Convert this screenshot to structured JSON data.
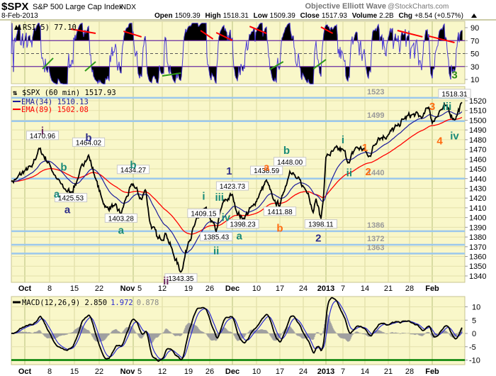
{
  "header": {
    "symbol": "$SPX",
    "name": "S&P 500 Large Cap Index",
    "exchange": "INDX",
    "brand": "Objective Elliott Wave",
    "source": "@StockCharts.com",
    "date": "8-Feb-2013",
    "open_label": "Open",
    "open": "1509.39",
    "high_label": "High",
    "high": "1518.31",
    "low_label": "Low",
    "low": "1509.39",
    "close_label": "Close",
    "close": "1517.93",
    "volume_label": "Volume",
    "volume": "2.2B",
    "chg_label": "Chg",
    "chg": "+8.54 (+0.57%)",
    "chg_icon": "triangle-up-icon"
  },
  "colors": {
    "panel_bg": "#f9f7c9",
    "price": "#000000",
    "ema34": "#1c1c9c",
    "ema89": "#ff0000",
    "level_line": "#9cc8ec",
    "rsi_line": "#4b3bd6",
    "macd_line": "#000000",
    "signal_line": "#2a2ad0",
    "histogram": "#a0a0a0",
    "wave_purple": "#6e2a60",
    "wave_navy": "#2e2e8a",
    "wave_teal": "#198a78",
    "wave_orange": "#ff6a10",
    "wave_green": "#2e8a1a"
  },
  "chart_data": [
    {
      "type": "line",
      "panel": "rsi",
      "legend": "RSI(5) 77.10",
      "ylim": [
        0,
        100
      ],
      "yticks": [
        90,
        70,
        50,
        30,
        10
      ],
      "overbought": 70,
      "oversold": 30,
      "annotations": [
        {
          "kind": "trendline",
          "color": "red",
          "from": [
            "2012-10-14",
            87.8
          ],
          "to": [
            "2012-10-21",
            81.2
          ]
        },
        {
          "kind": "trendline",
          "color": "red",
          "from": [
            "2012-11-01",
            84.5
          ],
          "to": [
            "2012-11-07",
            75.8
          ]
        },
        {
          "kind": "trendline",
          "color": "red",
          "from": [
            "2012-11-23",
            85.6
          ],
          "to": [
            "2012-11-27",
            72.5
          ]
        },
        {
          "kind": "trendline",
          "color": "red",
          "from": [
            "2012-11-28",
            82.3
          ],
          "to": [
            "2012-12-03",
            70.3
          ]
        },
        {
          "kind": "trendline",
          "color": "red",
          "from": [
            "2012-12-08",
            92
          ],
          "to": [
            "2012-12-13",
            81.2
          ]
        },
        {
          "kind": "trendline",
          "color": "red",
          "from": [
            "2012-12-31",
            91
          ],
          "to": [
            "2013-01-04",
            81.2
          ]
        },
        {
          "kind": "trendline",
          "color": "red",
          "from": [
            "2013-01-24",
            85.6
          ],
          "to": [
            "2013-02-01",
            75.8
          ]
        },
        {
          "kind": "trendline",
          "color": "red",
          "from": [
            "2013-02-03",
            76.9
          ],
          "to": [
            "2013-02-07",
            67
          ]
        },
        {
          "kind": "trendline",
          "color": "green",
          "from": [
            "2012-10-06",
            26.4
          ],
          "to": [
            "2012-10-09",
            42.9
          ]
        },
        {
          "kind": "trendline",
          "color": "green",
          "from": [
            "2012-10-18",
            23
          ],
          "to": [
            "2012-10-21",
            37.4
          ]
        },
        {
          "kind": "trendline",
          "color": "green",
          "from": [
            "2012-11-12",
            15.5
          ],
          "to": [
            "2012-11-17",
            19.9
          ]
        },
        {
          "kind": "trendline",
          "color": "green",
          "from": [
            "2012-12-14",
            25.3
          ],
          "to": [
            "2012-12-18",
            37.4
          ]
        },
        {
          "kind": "trendline",
          "color": "green",
          "from": [
            "2012-12-28",
            26.4
          ],
          "to": [
            "2013-01-02",
            40.7
          ]
        }
      ],
      "wave_labels": [
        {
          "text": "3",
          "color": "wave_green",
          "date": "2013-02-07",
          "value": 17
        }
      ]
    },
    {
      "type": "line",
      "panel": "price",
      "title": "$SPX (60 min) 1517.93",
      "ylim": [
        1335,
        1528
      ],
      "yticks": [
        1520,
        1510,
        1500,
        1490,
        1480,
        1470,
        1460,
        1450,
        1440,
        1430,
        1420,
        1410,
        1400,
        1390,
        1380,
        1370,
        1360,
        1350,
        1340
      ],
      "series": [
        {
          "name": "$SPX (60 min)",
          "points": [
            [
              "2012-09-26",
              1437
            ],
            [
              "2012-09-28",
              1440
            ],
            [
              "2012-10-01",
              1448
            ],
            [
              "2012-10-03",
              1452
            ],
            [
              "2012-10-05",
              1471
            ],
            [
              "2012-10-08",
              1455
            ],
            [
              "2012-10-10",
              1440
            ],
            [
              "2012-10-12",
              1430
            ],
            [
              "2012-10-14",
              1425.5
            ],
            [
              "2012-10-16",
              1440
            ],
            [
              "2012-10-18",
              1458
            ],
            [
              "2012-10-19",
              1464
            ],
            [
              "2012-10-21",
              1440
            ],
            [
              "2012-10-23",
              1420
            ],
            [
              "2012-10-25",
              1410
            ],
            [
              "2012-10-28",
              1412
            ],
            [
              "2012-10-31",
              1403.3
            ],
            [
              "2012-11-02",
              1420
            ],
            [
              "2012-11-05",
              1434.3
            ],
            [
              "2012-11-07",
              1418
            ],
            [
              "2012-11-08",
              1430
            ],
            [
              "2012-11-09",
              1395
            ],
            [
              "2012-11-11",
              1378
            ],
            [
              "2012-11-13",
              1384
            ],
            [
              "2012-11-15",
              1362
            ],
            [
              "2012-11-17",
              1343.4
            ],
            [
              "2012-11-19",
              1375
            ],
            [
              "2012-11-21",
              1392
            ],
            [
              "2012-11-24",
              1409.2
            ],
            [
              "2012-11-26",
              1400
            ],
            [
              "2012-11-28",
              1385.4
            ],
            [
              "2012-11-30",
              1415
            ],
            [
              "2012-12-03",
              1423.7
            ],
            [
              "2012-12-04",
              1408
            ],
            [
              "2012-12-06",
              1398.2
            ],
            [
              "2012-12-09",
              1412
            ],
            [
              "2012-12-11",
              1425
            ],
            [
              "2012-12-13",
              1438.6
            ],
            [
              "2012-12-15",
              1418
            ],
            [
              "2012-12-17",
              1411.9
            ],
            [
              "2012-12-18",
              1425
            ],
            [
              "2012-12-20",
              1448
            ],
            [
              "2012-12-22",
              1440
            ],
            [
              "2012-12-24",
              1432
            ],
            [
              "2012-12-26",
              1425
            ],
            [
              "2012-12-28",
              1405
            ],
            [
              "2012-12-29",
              1420
            ],
            [
              "2012-12-31",
              1398.1
            ],
            [
              "2013-01-01",
              1420
            ],
            [
              "2013-01-02",
              1462
            ],
            [
              "2013-01-04",
              1468
            ],
            [
              "2013-01-07",
              1470
            ],
            [
              "2013-01-09",
              1456
            ],
            [
              "2013-01-11",
              1472
            ],
            [
              "2013-01-14",
              1470
            ],
            [
              "2013-01-15",
              1462
            ],
            [
              "2013-01-18",
              1482
            ],
            [
              "2013-01-21",
              1485
            ],
            [
              "2013-01-24",
              1494
            ],
            [
              "2013-01-26",
              1501
            ],
            [
              "2013-01-29",
              1506
            ],
            [
              "2013-02-01",
              1503
            ],
            [
              "2013-02-03",
              1514
            ],
            [
              "2013-02-04",
              1497
            ],
            [
              "2013-02-05",
              1510
            ],
            [
              "2013-02-06",
              1514
            ],
            [
              "2013-02-07",
              1500
            ],
            [
              "2013-02-08",
              1518.3
            ]
          ]
        }
      ],
      "legend": [
        {
          "label": "EMA(34) 1510.13",
          "color": "ema34"
        },
        {
          "label": "EMA(89) 1502.08",
          "color": "ema89"
        }
      ],
      "levels": [
        {
          "value": 1523,
          "label": "1523"
        },
        {
          "value": 1499,
          "label": "1499"
        },
        {
          "value": 1440,
          "label": "1440"
        },
        {
          "value": 1386,
          "label": "1386"
        },
        {
          "value": 1372,
          "label": "1372"
        },
        {
          "value": 1363,
          "label": "1363"
        }
      ],
      "price_boxes": [
        {
          "text": "1470.96",
          "date": "2012-10-06",
          "price": 1483
        },
        {
          "text": "1464.02",
          "date": "2012-10-19",
          "price": 1476
        },
        {
          "text": "1425.53",
          "date": "2012-10-14",
          "price": 1419
        },
        {
          "text": "1434.27",
          "date": "2012-11-05",
          "price": 1448
        },
        {
          "text": "1403.28",
          "date": "2012-10-31",
          "price": 1398
        },
        {
          "text": "1343.35",
          "date": "2012-11-17",
          "price": 1336.5
        },
        {
          "text": "1409.15",
          "date": "2012-11-24",
          "price": 1403
        },
        {
          "text": "1423.73",
          "date": "2012-12-03",
          "price": 1431
        },
        {
          "text": "1385.43",
          "date": "2012-11-28",
          "price": 1379
        },
        {
          "text": "1398.23",
          "date": "2012-12-06",
          "price": 1392
        },
        {
          "text": "1438.59",
          "date": "2012-12-13",
          "price": 1447
        },
        {
          "text": "1448.00",
          "date": "2012-12-20",
          "price": 1456
        },
        {
          "text": "1411.88",
          "date": "2012-12-17",
          "price": 1405
        },
        {
          "text": "1398.11",
          "date": "2012-12-31",
          "price": 1392
        },
        {
          "text": "1518.31",
          "date": "2013-02-07",
          "price": 1526
        }
      ],
      "wave_labels": [
        {
          "text": "i",
          "color": "wave_purple",
          "date": "2012-10-06",
          "price": 1489
        },
        {
          "text": "b",
          "color": "wave_navy",
          "date": "2012-10-19",
          "price": 1482
        },
        {
          "text": "b",
          "color": "wave_teal",
          "date": "2012-10-12",
          "price": 1452
        },
        {
          "text": "a",
          "color": "wave_teal",
          "date": "2012-10-10",
          "price": 1424
        },
        {
          "text": "a",
          "color": "wave_navy",
          "date": "2012-10-13",
          "price": 1408
        },
        {
          "text": "b",
          "color": "wave_teal",
          "date": "2012-11-05",
          "price": 1454
        },
        {
          "text": "a",
          "color": "wave_teal",
          "date": "2012-10-31",
          "price": 1387
        },
        {
          "text": "ii",
          "color": "wave_purple",
          "date": "2012-11-13",
          "price": 1335
        },
        {
          "text": "i",
          "color": "wave_teal",
          "date": "2012-11-24",
          "price": 1422
        },
        {
          "text": "iii",
          "color": "wave_teal",
          "date": "2012-11-29",
          "price": 1421
        },
        {
          "text": "iv",
          "color": "wave_teal",
          "date": "2012-12-01",
          "price": 1400
        },
        {
          "text": "1",
          "color": "wave_navy",
          "date": "2012-12-02",
          "price": 1448
        },
        {
          "text": "ii",
          "color": "wave_teal",
          "date": "2012-11-28",
          "price": 1366
        },
        {
          "text": "a",
          "color": "wave_teal",
          "date": "2012-12-05",
          "price": 1381
        },
        {
          "text": "a",
          "color": "wave_orange",
          "date": "2012-12-13",
          "price": 1452
        },
        {
          "text": "b",
          "color": "wave_teal",
          "date": "2012-12-19",
          "price": 1469
        },
        {
          "text": "b",
          "color": "wave_orange",
          "date": "2012-12-17",
          "price": 1389
        },
        {
          "text": "2",
          "color": "wave_navy",
          "date": "2012-12-30",
          "price": 1379
        },
        {
          "text": "i",
          "color": "wave_teal",
          "date": "2013-01-07",
          "price": 1480
        },
        {
          "text": "ii",
          "color": "wave_teal",
          "date": "2013-01-09",
          "price": 1446
        },
        {
          "text": "1",
          "color": "wave_orange",
          "date": "2013-01-14",
          "price": 1472
        },
        {
          "text": "2",
          "color": "wave_orange",
          "date": "2013-01-15",
          "price": 1447
        },
        {
          "text": "3",
          "color": "wave_orange",
          "date": "2013-02-04",
          "price": 1514
        },
        {
          "text": "iii",
          "color": "wave_teal",
          "date": "2013-02-06",
          "price": 1514
        },
        {
          "text": "4",
          "color": "wave_orange",
          "date": "2013-02-05",
          "price": 1479
        },
        {
          "text": "iv",
          "color": "wave_teal",
          "date": "2013-02-07",
          "price": 1484
        }
      ]
    },
    {
      "type": "line",
      "panel": "macd",
      "legend": [
        {
          "label": "MACD(12,26,9) 2.850",
          "color": "macd_line"
        },
        {
          "label": "1.972",
          "color": "signal_line"
        },
        {
          "label": "0.878",
          "color": "histogram"
        }
      ],
      "ylim": [
        -11,
        13
      ],
      "yticks": [
        10,
        5,
        0,
        -5,
        -10
      ],
      "reference_line": {
        "value": -10,
        "color": "#008000"
      }
    }
  ],
  "xaxis": {
    "ticks": [
      {
        "date": "2012-10-01",
        "label": "Oct",
        "bold": true
      },
      {
        "date": "2012-10-08",
        "label": "8"
      },
      {
        "date": "2012-10-15",
        "label": "15"
      },
      {
        "date": "2012-10-22",
        "label": "22"
      },
      {
        "date": "2012-11-05",
        "label": "Nov",
        "bold": true,
        "suffix": "5"
      },
      {
        "date": "2012-11-12",
        "label": "12"
      },
      {
        "date": "2012-11-19",
        "label": "19"
      },
      {
        "date": "2012-11-26",
        "label": "26"
      },
      {
        "date": "2012-12-03",
        "label": "Dec",
        "bold": true
      },
      {
        "date": "2012-12-10",
        "label": "10"
      },
      {
        "date": "2012-12-17",
        "label": "17"
      },
      {
        "date": "2012-12-24",
        "label": "24"
      },
      {
        "date": "2013-01-02",
        "label": "2013",
        "bold": true
      },
      {
        "date": "2013-01-07",
        "label": "7"
      },
      {
        "date": "2013-01-14",
        "label": "14"
      },
      {
        "date": "2013-01-21",
        "label": "21"
      },
      {
        "date": "2013-01-28",
        "label": "28"
      },
      {
        "date": "2013-02-04",
        "label": "Feb",
        "bold": true
      }
    ]
  }
}
